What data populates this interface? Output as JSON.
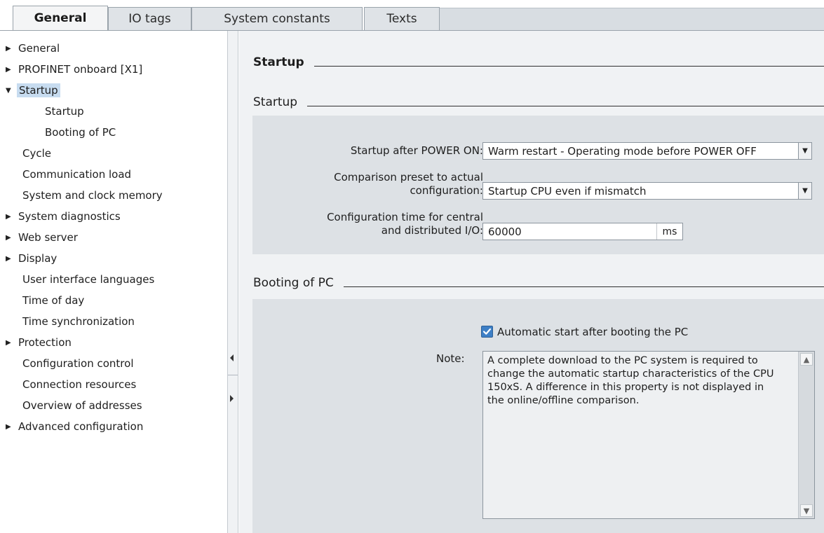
{
  "tabs": [
    {
      "label": "General",
      "active": true
    },
    {
      "label": "IO tags",
      "active": false
    },
    {
      "label": "System constants",
      "active": false
    },
    {
      "label": "Texts",
      "active": false
    }
  ],
  "nav": {
    "items": [
      {
        "label": "General",
        "arrow": "collapsed"
      },
      {
        "label": "PROFINET onboard [X1]",
        "arrow": "collapsed"
      },
      {
        "label": "Startup",
        "arrow": "expanded",
        "selected": true
      },
      {
        "label": "Startup",
        "child": true
      },
      {
        "label": "Booting of PC",
        "child": true
      },
      {
        "label": "Cycle"
      },
      {
        "label": "Communication load"
      },
      {
        "label": "System and clock memory"
      },
      {
        "label": "System diagnostics",
        "arrow": "collapsed"
      },
      {
        "label": "Web server",
        "arrow": "collapsed"
      },
      {
        "label": "Display",
        "arrow": "collapsed"
      },
      {
        "label": "User interface languages"
      },
      {
        "label": "Time of day"
      },
      {
        "label": "Time synchronization"
      },
      {
        "label": "Protection",
        "arrow": "collapsed"
      },
      {
        "label": "Configuration control"
      },
      {
        "label": "Connection resources"
      },
      {
        "label": "Overview of addresses"
      },
      {
        "label": "Advanced configuration",
        "arrow": "collapsed"
      }
    ]
  },
  "content": {
    "main_title": "Startup",
    "startup_section": {
      "title": "Startup",
      "startup_after_power_on_label": "Startup after POWER ON:",
      "startup_after_power_on_value": "Warm restart - Operating mode before POWER OFF",
      "comparison_label_line1": "Comparison preset to actual",
      "comparison_label_line2": "configuration:",
      "comparison_value": "Startup CPU even if mismatch",
      "config_time_label_line1": "Configuration time for central",
      "config_time_label_line2": "and distributed I/O:",
      "config_time_value": "60000",
      "config_time_unit": "ms"
    },
    "booting_section": {
      "title": "Booting of PC",
      "auto_start_label": "Automatic start after booting the PC",
      "auto_start_checked": true,
      "note_label": "Note:",
      "note_text": "A complete download to the PC system is required to change the automatic startup characteristics of the CPU 150xS. A difference in this property is not displayed in the online/offline comparison."
    }
  },
  "colors": {
    "selected_bg": "#c7dcf0",
    "panel_bg": "#dde1e5",
    "checkbox_blue": "#3d7fc6"
  }
}
